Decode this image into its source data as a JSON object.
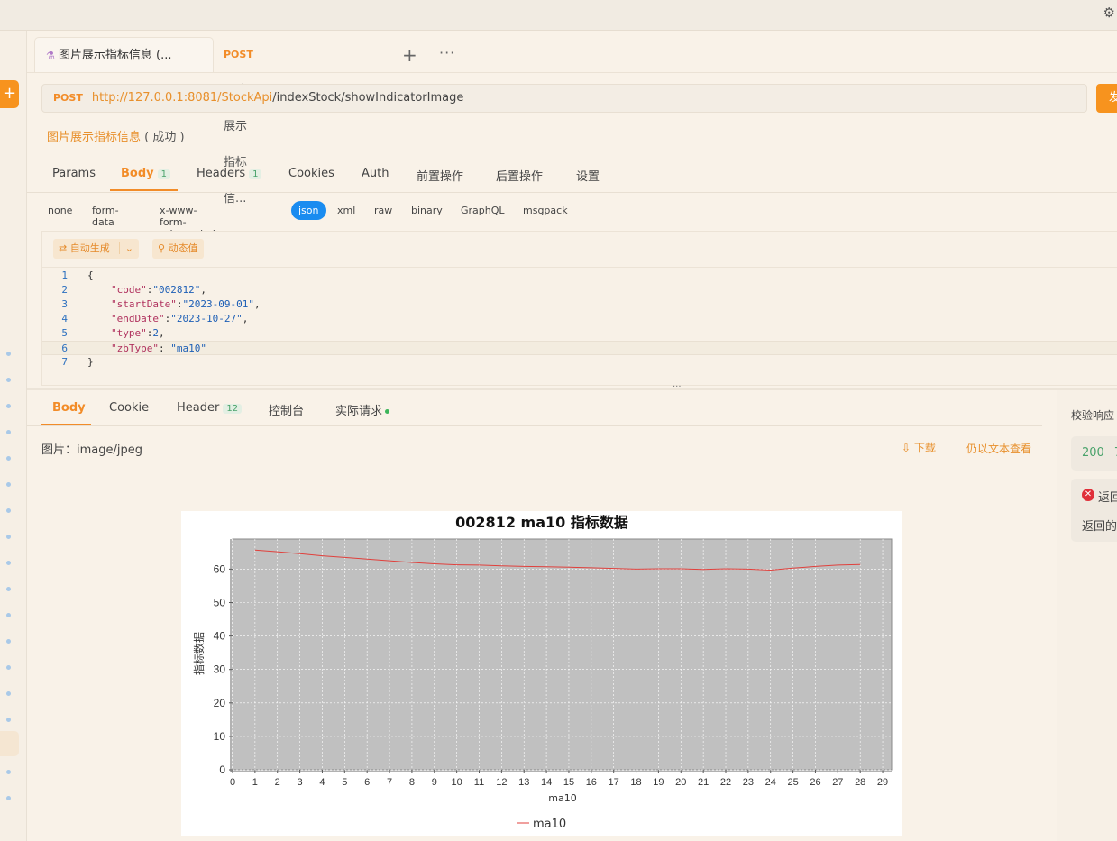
{
  "tabs": [
    {
      "icon": "tab-post-icon",
      "label": "图片展示指标信息 (...",
      "method": ""
    },
    {
      "method": "POST",
      "label": "图片展示指标信..."
    }
  ],
  "tab_actions": {
    "add": "+",
    "more": "···"
  },
  "request": {
    "method": "POST",
    "url_base": "http://127.0.0.1:8081/StockApi",
    "url_path": "/indexStock/showIndicatorImage",
    "send_label": "发",
    "name": "图片展示指标信息",
    "status_text": "( 成功 )"
  },
  "request_tabs": [
    {
      "label": "Params",
      "badge": ""
    },
    {
      "label": "Body",
      "badge": "1"
    },
    {
      "label": "Headers",
      "badge": "1"
    },
    {
      "label": "Cookies",
      "badge": ""
    },
    {
      "label": "Auth",
      "badge": ""
    },
    {
      "label": "前置操作",
      "badge": ""
    },
    {
      "label": "后置操作",
      "badge": ""
    },
    {
      "label": "设置",
      "badge": ""
    }
  ],
  "body_types": [
    "none",
    "form-data",
    "x-www-form-urlencoded",
    "json",
    "xml",
    "raw",
    "binary",
    "GraphQL",
    "msgpack"
  ],
  "body_type_selected": "json",
  "editor_toolbar": {
    "auto_generate": "自动生成",
    "dynamic_value": "动态值"
  },
  "code_lines": [
    {
      "n": "1",
      "text": "{"
    },
    {
      "n": "2",
      "key": "\"code\"",
      "val": "\"002812\"",
      "tail": ","
    },
    {
      "n": "3",
      "key": "\"startDate\"",
      "val": "\"2023-09-01\"",
      "tail": ","
    },
    {
      "n": "4",
      "key": "\"endDate\"",
      "val": "\"2023-10-27\"",
      "tail": ","
    },
    {
      "n": "5",
      "key": "\"type\"",
      "val": "2",
      "tail": ","
    },
    {
      "n": "6",
      "key": "\"zbType\"",
      "val": " \"ma10\"",
      "tail": ""
    },
    {
      "n": "7",
      "text": "}"
    }
  ],
  "response_tabs": [
    {
      "label": "Body",
      "badge": ""
    },
    {
      "label": "Cookie",
      "badge": ""
    },
    {
      "label": "Header",
      "badge": "12"
    },
    {
      "label": "控制台",
      "badge": ""
    },
    {
      "label": "实际请求",
      "badge": ""
    }
  ],
  "response": {
    "image_type": "图片：image/jpeg",
    "download": "下载",
    "view_as_text": "仍以文本查看"
  },
  "right_panel": {
    "title": "校验响应",
    "status_code": "200",
    "status_extra": "7",
    "return_1": "返回",
    "return_2": "返回的"
  },
  "chart_data": {
    "type": "line",
    "title": "002812 ma10 指标数据",
    "xlabel": "ma10",
    "ylabel": "指标数据",
    "x_ticks": [
      0,
      1,
      2,
      3,
      4,
      5,
      6,
      7,
      8,
      9,
      10,
      11,
      12,
      13,
      14,
      15,
      16,
      17,
      18,
      19,
      20,
      21,
      22,
      23,
      24,
      25,
      26,
      27,
      28,
      29
    ],
    "y_ticks": [
      0,
      10,
      20,
      30,
      40,
      50,
      60
    ],
    "xlim": [
      0,
      29.4
    ],
    "ylim": [
      0,
      69
    ],
    "grid": true,
    "legend_position": "bottom-center",
    "series": [
      {
        "name": "ma10",
        "color": "#e0403c",
        "x": [
          1,
          2,
          3,
          4,
          5,
          6,
          7,
          8,
          9,
          10,
          11,
          12,
          13,
          14,
          15,
          16,
          17,
          18,
          19,
          20,
          21,
          22,
          23,
          24,
          25,
          26,
          27,
          28
        ],
        "values": [
          65.7,
          65.2,
          64.6,
          64.0,
          63.5,
          63.0,
          62.5,
          62.0,
          61.6,
          61.3,
          61.2,
          61.0,
          60.8,
          60.7,
          60.6,
          60.4,
          60.2,
          60.0,
          60.1,
          60.1,
          59.9,
          60.1,
          60.0,
          59.7,
          60.3,
          60.8,
          61.2,
          61.4
        ]
      }
    ],
    "plot_background": "#c0c0c0"
  }
}
